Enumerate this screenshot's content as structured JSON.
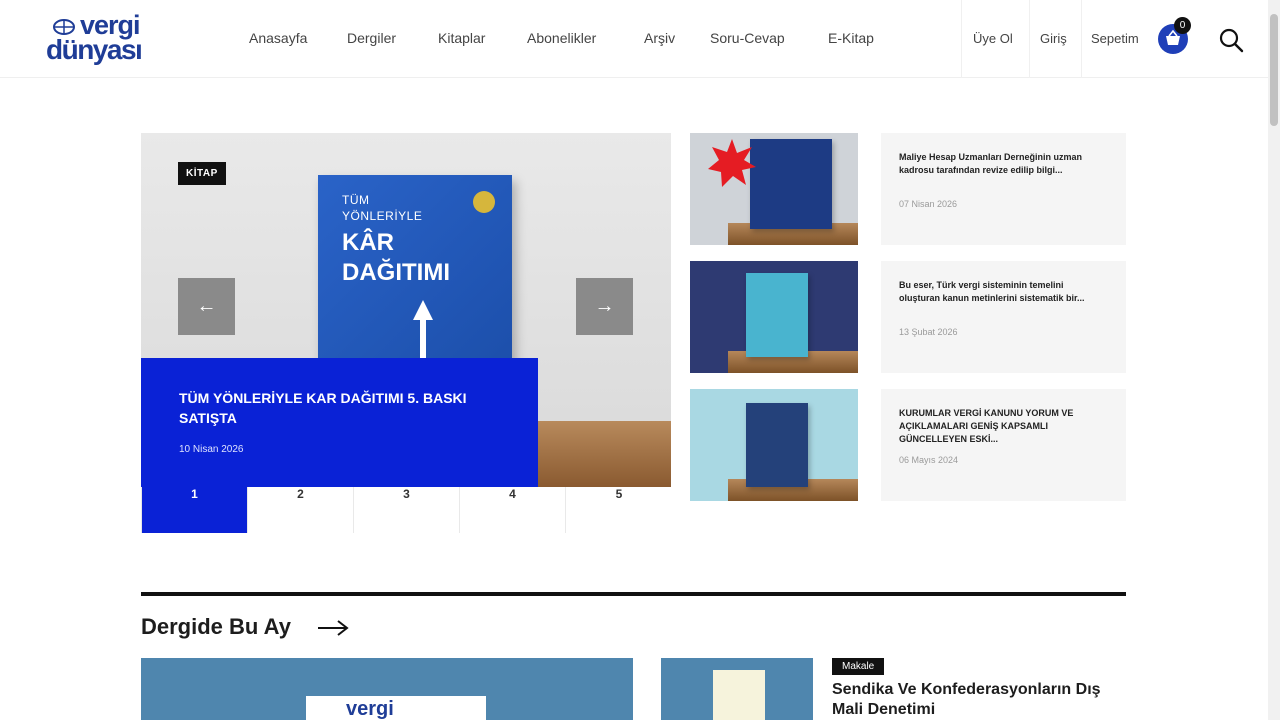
{
  "brand": {
    "line1": "vergi",
    "line2": "dünyası"
  },
  "nav": [
    "Anasayfa",
    "Dergiler",
    "Kitaplar",
    "Abonelikler",
    "Arşiv",
    "Soru-Cevap",
    "E-Kitap"
  ],
  "util": {
    "register": "Üye Ol",
    "login": "Giriş",
    "cart": "Sepetim",
    "cart_count": "0"
  },
  "hero": {
    "tag": "KİTAP",
    "book": {
      "line1": "TÜM",
      "line2": "YÖNLERİYLE",
      "line3": "KÂR",
      "line4": "DAĞITIMI"
    },
    "title": "TÜM YÖNLERİYLE KAR DAĞITIMI 5. BASKI SATIŞTA",
    "date": "10 Nisan 2026",
    "prev": "←",
    "next": "→",
    "pages": [
      "1",
      "2",
      "3",
      "4",
      "5"
    ]
  },
  "cards": [
    {
      "title": "Maliye Hesap Uzmanları Derneğinin uzman kadrosu tarafından revize edilip bilgi...",
      "date": "07 Nisan 2026"
    },
    {
      "title": "Bu eser, Türk vergi sisteminin temelini oluşturan kanun metinlerini sistematik bir...",
      "date": "13 Şubat 2026"
    },
    {
      "title": "KURUMLAR VERGİ KANUNU YORUM VE AÇIKLAMALARI GENİŞ KAPSAMLI GÜNCELLEYEN ESKİ...",
      "date": "06 Mayıs 2024"
    }
  ],
  "section": {
    "title": "Dergide Bu Ay",
    "feature_brand": "vergi",
    "badge": "Makale",
    "article_title": "Sendika Ve Konfederasyonların Dış Mali Denetimi"
  }
}
